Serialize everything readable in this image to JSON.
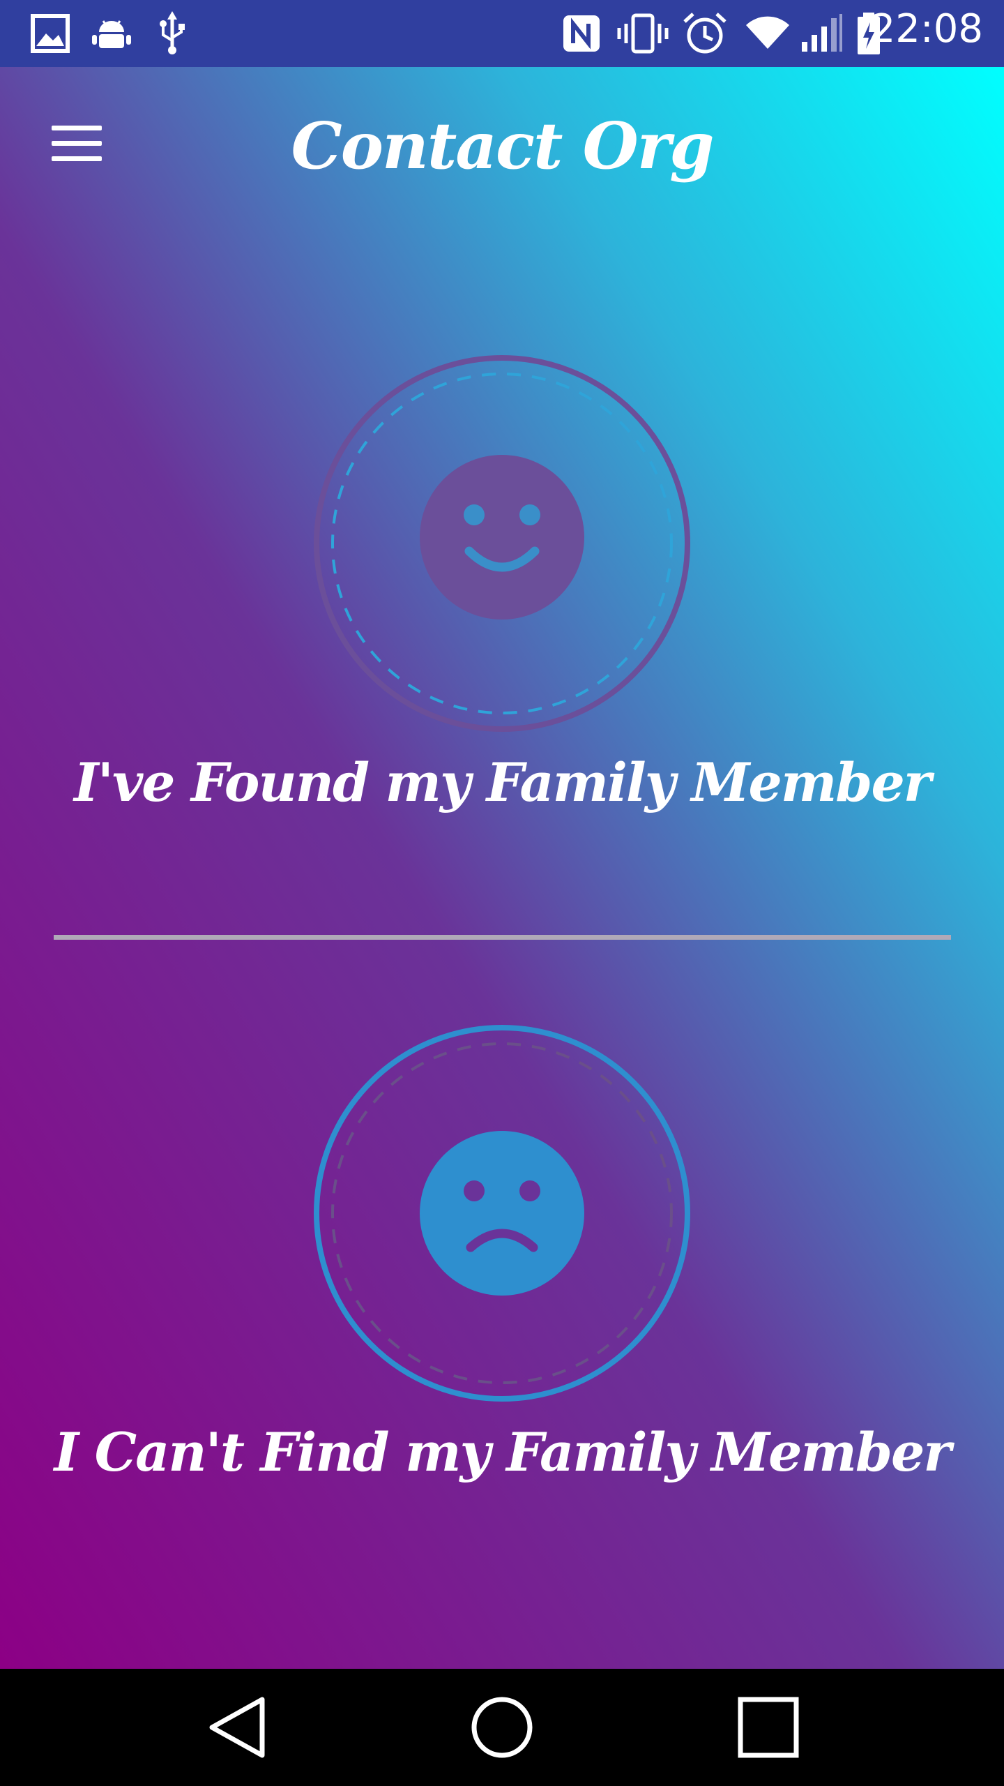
{
  "status_bar": {
    "time": "22:08",
    "icons": [
      "image-icon",
      "android-icon",
      "usb-icon",
      "nfc-icon",
      "vibrate-icon",
      "alarm-icon",
      "wifi-icon",
      "signal-icon",
      "battery-charging-icon"
    ]
  },
  "app_bar": {
    "title": "Contact Org",
    "menu_icon": "hamburger-menu-icon"
  },
  "options": [
    {
      "label": "I've Found my Family Member",
      "icon": "happy-face-icon",
      "ring_color": "#6b4f9a",
      "face_color": "#6b4f9a"
    },
    {
      "label": "I Can't Find my Family Member",
      "icon": "sad-face-icon",
      "ring_color": "#2e8fcf",
      "face_color": "#2e8fcf"
    }
  ],
  "nav_bar": {
    "icons": [
      "back-icon",
      "home-icon",
      "recents-icon"
    ]
  },
  "colors": {
    "status_bar": "#303f9f",
    "gradient_start": "#8c0085",
    "gradient_end": "#00ffff",
    "text": "#ffffff"
  }
}
